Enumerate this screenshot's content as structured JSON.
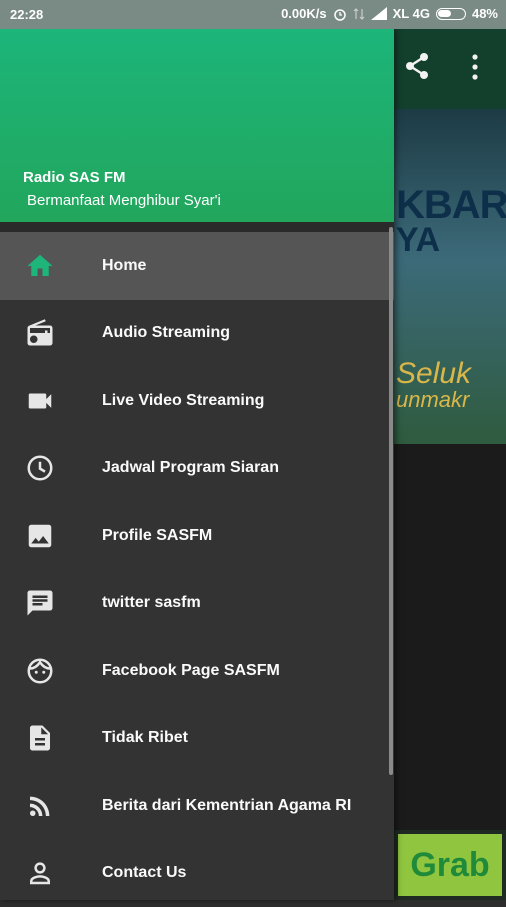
{
  "status_bar": {
    "time": "22:28",
    "net_speed": "0.00K/s",
    "carrier": "XL 4G",
    "battery": "48%"
  },
  "background_app": {
    "banner_line1": "KBAR",
    "banner_line2": "YA",
    "banner_script1": "Seluk",
    "banner_script2": "unmakr",
    "ad_text": "Grab"
  },
  "drawer": {
    "title": "Radio SAS FM",
    "subtitle": "Bermanfaat Menghibur Syar'i",
    "accent_color": "#1DB57A",
    "items": [
      {
        "label": "Home",
        "icon": "home-icon",
        "active": true
      },
      {
        "label": "Audio Streaming",
        "icon": "radio-icon"
      },
      {
        "label": "Live Video Streaming",
        "icon": "videocam-icon"
      },
      {
        "label": "Jadwal Program Siaran",
        "icon": "clock-icon"
      },
      {
        "label": "Profile SASFM",
        "icon": "image-icon"
      },
      {
        "label": "twitter sasfm",
        "icon": "message-icon"
      },
      {
        "label": "Facebook Page SASFM",
        "icon": "face-icon"
      },
      {
        "label": "Tidak Ribet",
        "icon": "document-icon"
      },
      {
        "label": "Berita dari Kementrian Agama RI",
        "icon": "rss-icon"
      },
      {
        "label": "Contact Us",
        "icon": "person-icon"
      }
    ]
  }
}
